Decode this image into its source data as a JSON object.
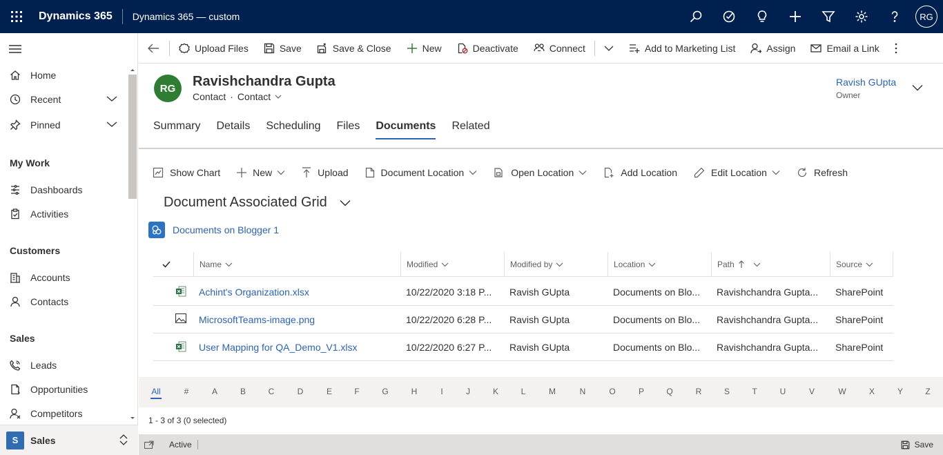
{
  "topbar": {
    "brand": "Dynamics 365",
    "app_name": "Dynamics 365 — custom",
    "user_initials": "RG",
    "icons": [
      "search-icon",
      "target-icon",
      "lightbulb-icon",
      "plus-icon",
      "filter-icon",
      "gear-icon",
      "help-icon"
    ]
  },
  "sidebar": {
    "items": [
      {
        "label": "Home",
        "icon": "home-icon"
      },
      {
        "label": "Recent",
        "icon": "clock-icon"
      },
      {
        "label": "Pinned",
        "icon": "pin-icon"
      }
    ],
    "groups": [
      {
        "title": "My Work",
        "items": [
          {
            "label": "Dashboards",
            "icon": "dashboard-icon"
          },
          {
            "label": "Activities",
            "icon": "clipboard-icon"
          }
        ]
      },
      {
        "title": "Customers",
        "items": [
          {
            "label": "Accounts",
            "icon": "building-icon"
          },
          {
            "label": "Contacts",
            "icon": "person-icon"
          }
        ]
      },
      {
        "title": "Sales",
        "items": [
          {
            "label": "Leads",
            "icon": "phone-icon"
          },
          {
            "label": "Opportunities",
            "icon": "document-icon"
          },
          {
            "label": "Competitors",
            "icon": "person-icon"
          }
        ]
      }
    ],
    "area": {
      "initial": "S",
      "label": "Sales"
    }
  },
  "commandbar": {
    "upload_files": "Upload Files",
    "save": "Save",
    "save_close": "Save & Close",
    "new": "New",
    "deactivate": "Deactivate",
    "connect": "Connect",
    "add_marketing": "Add to Marketing List",
    "assign": "Assign",
    "email_link": "Email a Link"
  },
  "record": {
    "initials": "RG",
    "name": "Ravishchandra Gupta",
    "entity": "Contact",
    "form": "Contact",
    "owner_name": "Ravish GUpta",
    "owner_label": "Owner"
  },
  "tabs": [
    "Summary",
    "Details",
    "Scheduling",
    "Files",
    "Documents",
    "Related"
  ],
  "active_tab": "Documents",
  "subgrid": {
    "show_chart": "Show Chart",
    "new": "New",
    "upload": "Upload",
    "document_location": "Document Location",
    "open_location": "Open Location",
    "add_location": "Add Location",
    "edit_location": "Edit Location",
    "refresh": "Refresh"
  },
  "grid": {
    "title": "Document Associated Grid",
    "location_link": "Documents on Blogger 1",
    "headers": {
      "name": "Name",
      "modified": "Modified",
      "modified_by": "Modified by",
      "location": "Location",
      "path": "Path",
      "source": "Source"
    },
    "rows": [
      {
        "icon": "excel-icon",
        "name": "Achint's Organization.xlsx",
        "modified": "10/22/2020 3:18 P...",
        "modified_by": "Ravish GUpta",
        "location": "Documents on Blo...",
        "path": "Ravishchandra Gupta...",
        "source": "SharePoint"
      },
      {
        "icon": "image-icon",
        "name": "MicrosoftTeams-image.png",
        "modified": "10/22/2020 6:28 P...",
        "modified_by": "Ravish GUpta",
        "location": "Documents on Blo...",
        "path": "Ravishchandra Gupta...",
        "source": "SharePoint"
      },
      {
        "icon": "excel-icon",
        "name": "User Mapping for QA_Demo_V1.xlsx",
        "modified": "10/22/2020 6:27 P...",
        "modified_by": "Ravish GUpta",
        "location": "Documents on Blo...",
        "path": "Ravishchandra Gupta...",
        "source": "SharePoint"
      }
    ],
    "alphabet": [
      "All",
      "#",
      "A",
      "B",
      "C",
      "D",
      "E",
      "F",
      "G",
      "H",
      "I",
      "J",
      "K",
      "L",
      "M",
      "N",
      "O",
      "P",
      "Q",
      "R",
      "S",
      "T",
      "U",
      "V",
      "W",
      "X",
      "Y",
      "Z"
    ],
    "count_text": "1 - 3 of 3 (0 selected)"
  },
  "statusbar": {
    "status": "Active",
    "save": "Save"
  },
  "colors": {
    "topbar": "#002050",
    "link": "#2b63b9",
    "avatar": "#2f7d32",
    "sharepoint": "#2c73c7"
  }
}
